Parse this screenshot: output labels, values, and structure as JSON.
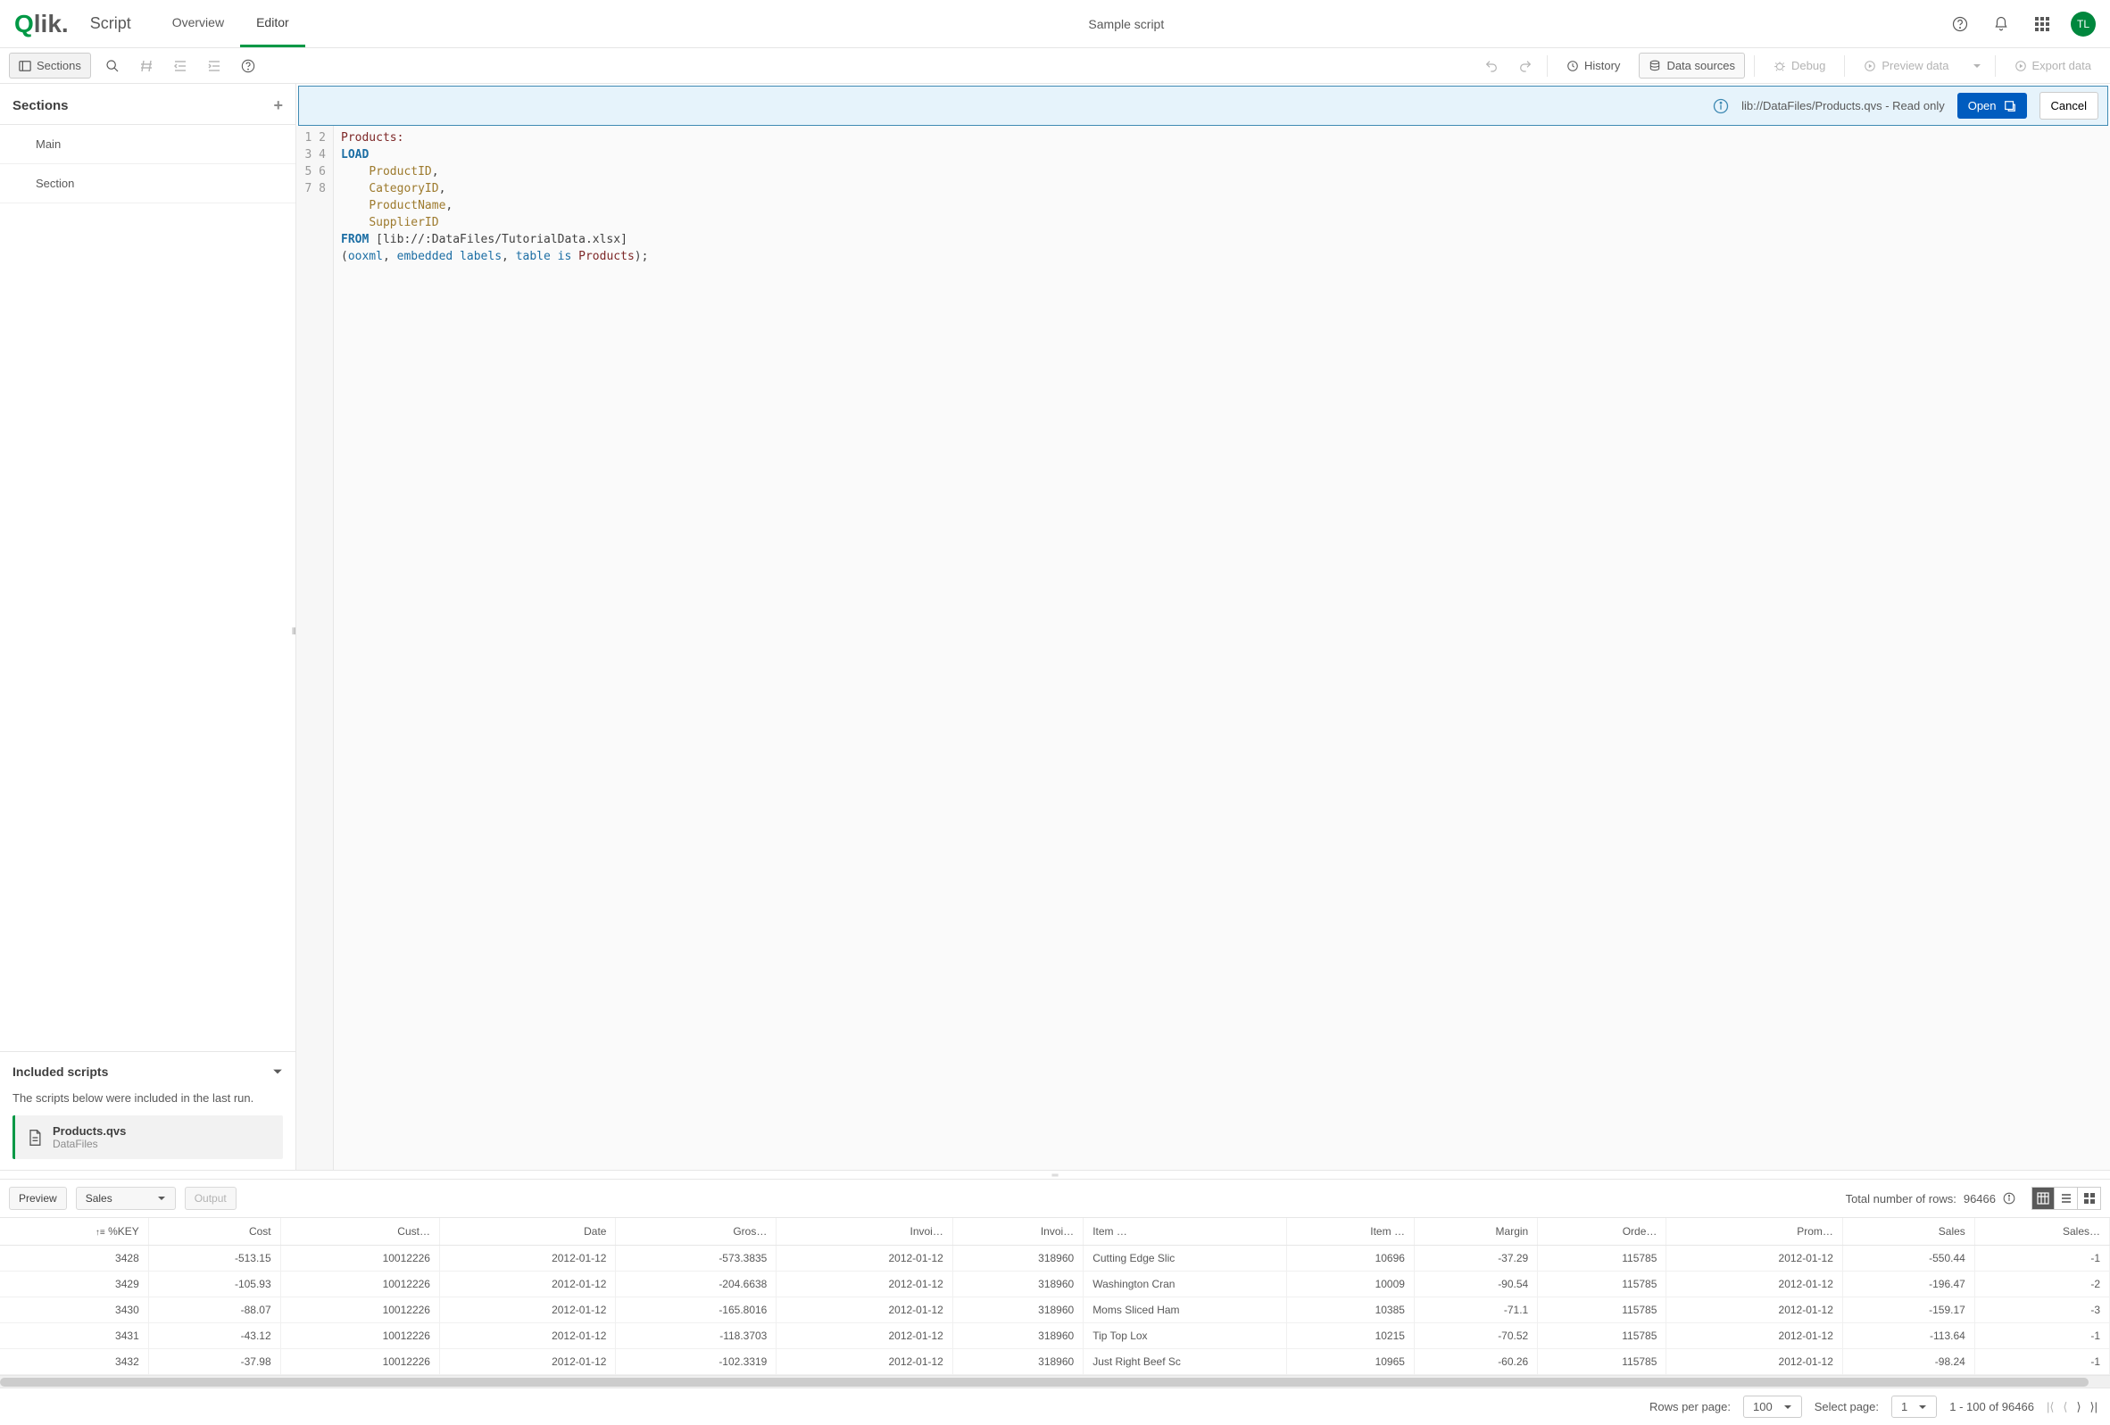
{
  "header": {
    "brand_q": "Q",
    "brand_rest": "lik",
    "script_label": "Script",
    "tabs": {
      "overview": "Overview",
      "editor": "Editor"
    },
    "title": "Sample script",
    "avatar": "TL"
  },
  "toolbar": {
    "sections": "Sections",
    "history": "History",
    "data_sources": "Data sources",
    "debug": "Debug",
    "preview_data": "Preview data",
    "export_data": "Export data"
  },
  "sidebar": {
    "title": "Sections",
    "items": [
      "Main",
      "Section"
    ],
    "included_title": "Included scripts",
    "included_note": "The scripts below were included in the last run.",
    "included": {
      "file": "Products.qvs",
      "location": "DataFiles"
    }
  },
  "notice": {
    "text": "lib://DataFiles/Products.qvs - Read only",
    "open": "Open",
    "cancel": "Cancel"
  },
  "code": {
    "line1_label": "Products:",
    "line2_kw": "LOAD",
    "line3_field": "ProductID",
    "line4_field": "CategoryID",
    "line5_field": "ProductName",
    "line6_field": "SupplierID",
    "line7_kw": "FROM",
    "line7_path": " [lib://:DataFiles/TutorialData.xlsx]",
    "line8_p1": "(",
    "line8_ooxml": "ooxml",
    "line8_c1": ", ",
    "line8_embedded": "embedded",
    "line8_sp1": " ",
    "line8_labels": "labels",
    "line8_c2": ", ",
    "line8_table": "table",
    "line8_sp2": " ",
    "line8_is": "is",
    "line8_sp3": " ",
    "line8_products": "Products",
    "line8_end": ");"
  },
  "preview": {
    "label": "Preview",
    "table_select": "Sales",
    "output": "Output",
    "total_label": "Total number of rows: ",
    "total_value": "96466",
    "columns": [
      "%KEY",
      "Cost",
      "Cust…",
      "Date",
      "Gros…",
      "Invoi…",
      "Invoi…",
      "Item …",
      "Item …",
      "Margin",
      "Orde…",
      "Prom…",
      "Sales",
      "Sales…"
    ],
    "col_align": [
      "r",
      "r",
      "r",
      "r",
      "r",
      "r",
      "r",
      "l",
      "r",
      "r",
      "r",
      "r",
      "r",
      "r"
    ],
    "rows": [
      [
        "3428",
        "-513.15",
        "10012226",
        "2012-01-12",
        "-573.3835",
        "2012-01-12",
        "318960",
        "Cutting Edge Slic",
        "10696",
        "-37.29",
        "115785",
        "2012-01-12",
        "-550.44",
        "-1"
      ],
      [
        "3429",
        "-105.93",
        "10012226",
        "2012-01-12",
        "-204.6638",
        "2012-01-12",
        "318960",
        "Washington Cran",
        "10009",
        "-90.54",
        "115785",
        "2012-01-12",
        "-196.47",
        "-2"
      ],
      [
        "3430",
        "-88.07",
        "10012226",
        "2012-01-12",
        "-165.8016",
        "2012-01-12",
        "318960",
        "Moms Sliced Ham",
        "10385",
        "-71.1",
        "115785",
        "2012-01-12",
        "-159.17",
        "-3"
      ],
      [
        "3431",
        "-43.12",
        "10012226",
        "2012-01-12",
        "-118.3703",
        "2012-01-12",
        "318960",
        "Tip Top Lox",
        "10215",
        "-70.52",
        "115785",
        "2012-01-12",
        "-113.64",
        "-1"
      ],
      [
        "3432",
        "-37.98",
        "10012226",
        "2012-01-12",
        "-102.3319",
        "2012-01-12",
        "318960",
        "Just Right Beef Sc",
        "10965",
        "-60.26",
        "115785",
        "2012-01-12",
        "-98.24",
        "-1"
      ]
    ]
  },
  "footer": {
    "rows_per_page_label": "Rows per page:",
    "rows_per_page_value": "100",
    "select_page_label": "Select page:",
    "select_page_value": "1",
    "range": "1 - 100 of 96466"
  }
}
